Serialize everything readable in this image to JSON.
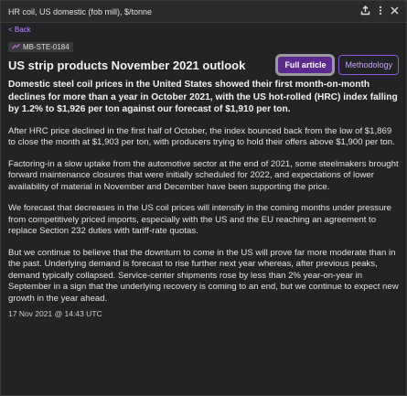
{
  "window": {
    "title": "HR coil, US domestic (fob mill), $/tonne"
  },
  "icons": {
    "export": "export-icon",
    "more": "more-vert-icon",
    "close": "close-icon",
    "trend": "trend-icon"
  },
  "nav": {
    "back_label": "< Back"
  },
  "article": {
    "tag": "MB-STE-0184",
    "headline": "US strip products November 2021 outlook",
    "lead": "Domestic steel coil prices in the United States showed their first month-on-month declines for more than a year in October 2021, with the US hot-rolled (HRC) index falling by 1.2% to $1,926 per ton against our forecast of $1,910 per ton.",
    "paragraphs": [
      "After HRC price declined in the first half of October, the index bounced back from the low of $1,869 to close the month at $1,903 per ton, with producers trying to hold their offers above $1,900 per ton.",
      "Factoring-in a slow uptake from the automotive sector at the end of 2021, some steelmakers brought forward maintenance closures that were initially scheduled for 2022, and expectations of lower availability of material in November and December have been supporting the price.",
      "We forecast that decreases in the US coil prices will intensify in the coming months under pressure from competitively priced imports, especially with the US and the EU reaching an agreement to replace Section 232 duties with tariff-rate quotas.",
      "But we continue to believe that the downturn to come in the US will prove far more moderate than in the past. Underlying demand is forecast to rise further next year whereas, after previous peaks, demand typically collapsed. Service-center shipments rose by less than 2% year-on-year in September in a sign that the underlying recovery is coming to an end, but we continue to expect new growth in the year ahead."
    ],
    "timestamp": "17 Nov 2021 @ 14:43 UTC"
  },
  "buttons": {
    "full_article": "Full article",
    "methodology": "Methodology"
  },
  "colors": {
    "accent": "#5a2a8e",
    "link": "#b98cff",
    "background": "#222324"
  }
}
